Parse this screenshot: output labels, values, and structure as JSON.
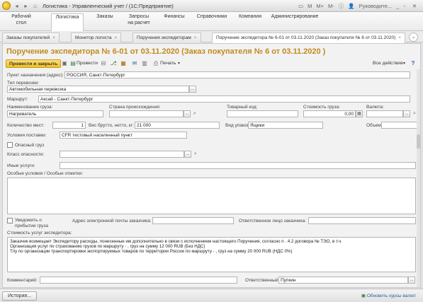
{
  "window": {
    "title": "Логистика - Управленческий учет / (1С:Предприятие)",
    "user": "Руководите...",
    "controls": [
      "▭",
      "M",
      "M+",
      "M-",
      "▭",
      "_",
      "▫"
    ]
  },
  "sections": [
    {
      "label": "Рабочий\nстол"
    },
    {
      "label": "Логистика"
    },
    {
      "label": "Заказы"
    },
    {
      "label": "Запросы\nна расчет"
    },
    {
      "label": "Финансы"
    },
    {
      "label": "Справочники"
    },
    {
      "label": "Компания"
    },
    {
      "label": "Администрирование"
    }
  ],
  "tabs": [
    {
      "label": "Заказы покупателей"
    },
    {
      "label": "Монитор логиста"
    },
    {
      "label": "Поручения экспедиторам"
    },
    {
      "label": "Поручение экспедитора № 6-01 от 03.11.2020 (Заказ покупателя № 6 от 03.11.2020)"
    }
  ],
  "doc": {
    "title": "Поручение экспедитора № 6-01 от 03.11.2020 (Заказ покупателя № 6 от 03.11.2020 )"
  },
  "toolbar": {
    "post_close": "Провести и закрыть",
    "post": "Провести",
    "print": "Печать",
    "all_actions": "Все действия"
  },
  "fields": {
    "destination_label": "Пункт назначения (адрес):",
    "destination": "РОССИЯ, Санкт-Петербург",
    "transport_label": "Тип перевозки:",
    "transport": "Автомобильная перевозка",
    "route_label": "Маршрут:",
    "route": "Аксай - Санкт-Петербург",
    "cargo_name_label": "Наименование груза:",
    "cargo_name": "Нагреватель",
    "origin_label": "Страна происхождения:",
    "origin": "",
    "hs_code_label": "Товарный код:",
    "hs_code": "",
    "cargo_cost_label": "Стоимость груза:",
    "cargo_cost": "0,00",
    "currency_label": "Валюта:",
    "currency": "",
    "qty_label": "Количество мест:",
    "qty": "1",
    "weight_label": "Вес брутто, нетто, кг:",
    "weight": "21 000",
    "packing_label": "Вид упаковки:",
    "packing": "Ящики",
    "volume_label": "Объем:",
    "volume": "",
    "terms_label": "Условия поставки:",
    "terms": "CFR тестовый населенный пункт",
    "dangerous_label": "Опасный груз",
    "hazard_label": "Класс опасности:",
    "hazard": "",
    "other_services_label": "Иные услуги:",
    "other_services": "",
    "special_label": "Особые условия / Особые отметки:",
    "notify_label": "Уведомить о прибытии груза",
    "email_label": "Адрес электронной почты заказчика:",
    "email": "",
    "responsible_customer_label": "Ответственное лицо заказчика:",
    "responsible_customer": "",
    "services_cost_label": "Стоимость услуг экспедитора:",
    "services_cost_lines": [
      "Заказчик возмещает Экспедитору расходы, понесенные им дополнительно в связи с исполнением настоящего Поручения, согласно п . 4.2 договора №  ТЭО, в т.ч.",
      "Организация услуг по страхованию грузов по маршруту  - , груз  на сумму 12 000 RUB (Без НДС)",
      "Тлу по организации транспортировки экспортируемых товаров по территории России  по маршруту  - , груз  на сумму 20 000 RUB (НДС 0%)"
    ],
    "comment_label": "Комментарий:",
    "comment": "",
    "responsible_label": "Ответственный:",
    "responsible": "Пупкин"
  },
  "status": {
    "history": "История...",
    "update_rates": "Обновить курсы валют"
  }
}
